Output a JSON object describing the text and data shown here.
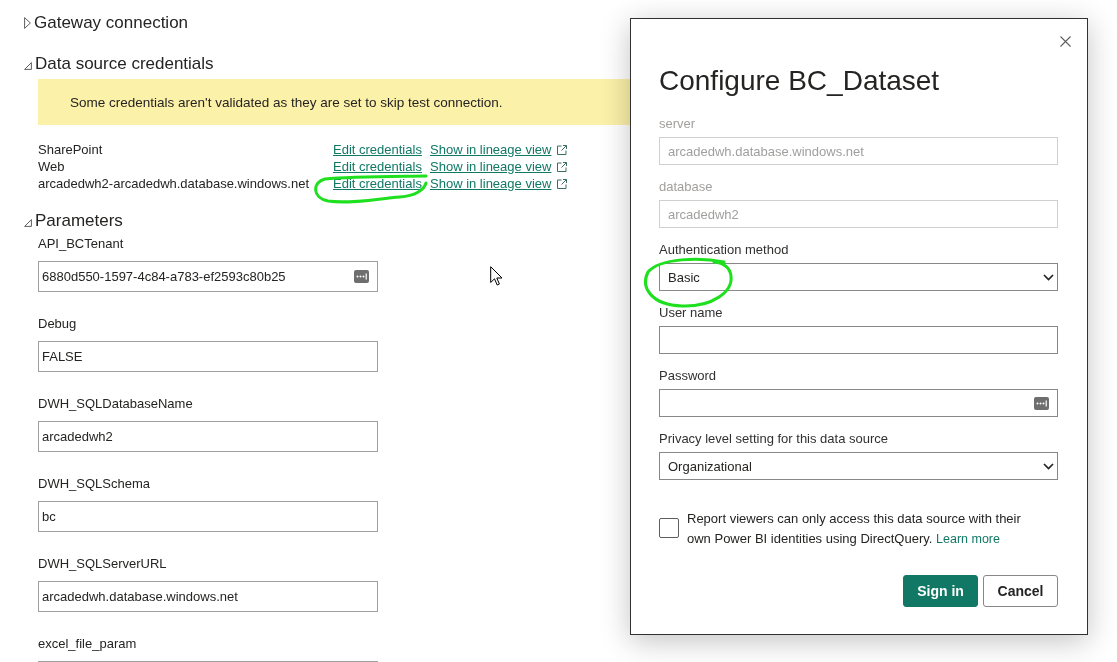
{
  "sections": [
    {
      "title": "Gateway connection",
      "expanded": false
    },
    {
      "title": "Data source credentials",
      "expanded": true,
      "banner": "Some credentials aren't validated as they are set to skip test connection.",
      "sources": [
        {
          "name": "SharePoint",
          "edit_link": "Edit credentials",
          "lineage_link": "Show in lineage view"
        },
        {
          "name": "Web",
          "edit_link": "Edit credentials",
          "lineage_link": "Show in lineage view"
        },
        {
          "name": "arcadedwh2-arcadedwh.database.windows.net",
          "edit_link": "Edit credentials",
          "lineage_link": "Show in lineage view"
        }
      ]
    },
    {
      "title": "Parameters",
      "expanded": true,
      "parameters": [
        {
          "label": "API_BCTenant",
          "value": "6880d550-1597-4c84-a783-ef2593c80b25",
          "autofill_icon": true
        },
        {
          "label": "Debug",
          "value": "FALSE",
          "autofill_icon": false
        },
        {
          "label": "DWH_SQLDatabaseName",
          "value": "arcadedwh2",
          "autofill_icon": false
        },
        {
          "label": "DWH_SQLSchema",
          "value": "bc",
          "autofill_icon": false
        },
        {
          "label": "DWH_SQLServerURL",
          "value": "arcadedwh.database.windows.net",
          "autofill_icon": false
        },
        {
          "label": "excel_file_param"
        }
      ]
    }
  ],
  "dialog": {
    "title": "Configure BC_Dataset",
    "fields": [
      {
        "kind": "input",
        "label": "server",
        "value": "arcadedwh.database.windows.net",
        "disabled": true,
        "autofill_icon": false
      },
      {
        "kind": "input",
        "label": "database",
        "value": "arcadedwh2",
        "disabled": true,
        "autofill_icon": false
      },
      {
        "kind": "select",
        "label": "Authentication method",
        "value": "Basic",
        "disabled": false
      },
      {
        "kind": "input",
        "label": "User name",
        "disabled": false,
        "autofill_icon": false
      },
      {
        "kind": "input",
        "label": "Password",
        "disabled": false,
        "autofill_icon": true
      },
      {
        "kind": "select",
        "label": "Privacy level setting for this data source",
        "value": "Organizational",
        "disabled": false
      }
    ],
    "checkbox": {
      "label": "Report viewers can only access this data source with their own Power BI identities using DirectQuery.",
      "link": "Learn more",
      "checked": false
    },
    "buttons": [
      {
        "label": "Sign in",
        "primary": true
      },
      {
        "label": "Cancel",
        "primary": false
      }
    ]
  }
}
